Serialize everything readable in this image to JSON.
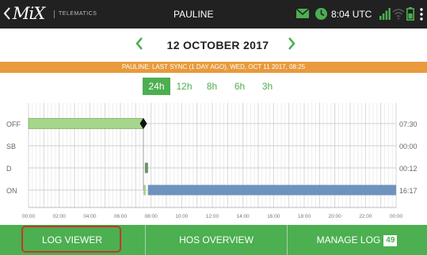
{
  "topbar": {
    "logo_text": "MiX",
    "logo_sub": "TELEMATICS",
    "title": "PAULINE",
    "time": "8:04 UTC",
    "icons": [
      "back-icon",
      "mail-icon",
      "clock-icon",
      "signal-icon",
      "wifi-icon",
      "battery-icon",
      "menu-icon"
    ]
  },
  "date_nav": {
    "date": "12 OCTOBER 2017",
    "prev_icon": "chevron-left-icon",
    "next_icon": "chevron-right-icon"
  },
  "sync_banner": "PAULINE: LAST SYNC (1 DAY AGO), WED, OCT 11 2017, 08:25",
  "range_tabs": [
    {
      "label": "24h",
      "active": true
    },
    {
      "label": "12h",
      "active": false
    },
    {
      "label": "8h",
      "active": false
    },
    {
      "label": "6h",
      "active": false
    },
    {
      "label": "3h",
      "active": false
    }
  ],
  "chart_data": {
    "type": "timeline",
    "rows": [
      "OFF",
      "SB",
      "D",
      "ON"
    ],
    "row_totals": [
      "07:30",
      "00:00",
      "00:12",
      "16:17"
    ],
    "x_ticks": [
      "00:00",
      "02:00",
      "04:00",
      "06:00",
      "08:00",
      "10:00",
      "12:00",
      "14:00",
      "16:00",
      "18:00",
      "20:00",
      "22:00",
      "00:00"
    ],
    "x_range_hours": [
      0,
      24
    ],
    "segments": [
      {
        "row": "OFF",
        "start": 0.0,
        "end": 7.5,
        "color": "#a5d68c"
      },
      {
        "row": "D",
        "start": 7.6,
        "end": 7.8,
        "color": "#6a8f6a"
      },
      {
        "row": "ON",
        "start": 7.5,
        "end": 7.6,
        "color": "#a5d68c"
      },
      {
        "row": "ON",
        "start": 7.8,
        "end": 24.0,
        "color": "#6e93bd"
      }
    ],
    "marker_hour": 7.5
  },
  "bottom_nav": {
    "log_viewer": "LOG VIEWER",
    "hos_overview": "HOS OVERVIEW",
    "manage_log": "MANAGE LOG",
    "manage_log_badge": "49"
  },
  "colors": {
    "topbar": "#212121",
    "accent_green": "#4caf50",
    "banner_orange": "#e89a3c",
    "highlight_red": "#c0392b"
  }
}
